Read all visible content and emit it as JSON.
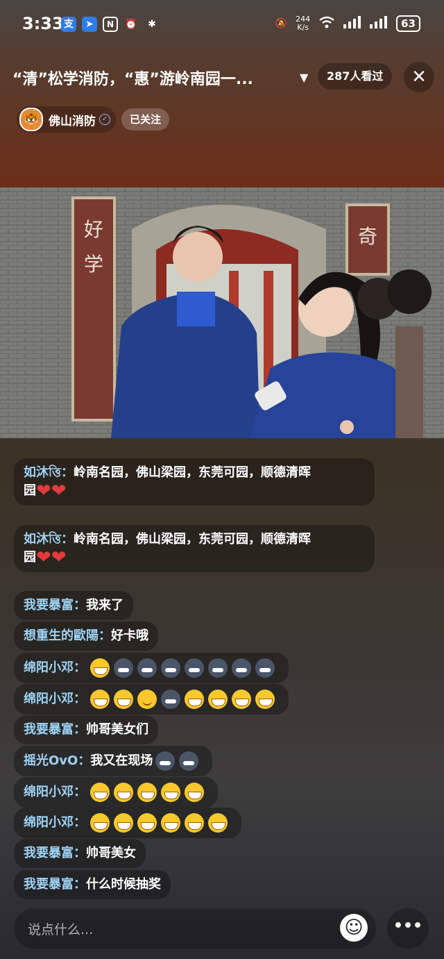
{
  "status_bar": {
    "time": "3:33",
    "icons_left": [
      "alipay-icon",
      "pin-icon",
      "nfc-icon",
      "alarm-off-icon",
      "bluetooth-icon"
    ],
    "speed_value": "244",
    "speed_unit": "K/s",
    "battery": "63"
  },
  "header": {
    "title": "“清”松学消防，“惠”游岭南园一...",
    "viewers": "287人看过",
    "close_icon": "close-icon"
  },
  "host": {
    "name": "佛山消防",
    "follow_label": "已关注"
  },
  "comments": [
    {
      "user": "如沐ত্তি：",
      "msg": "岭南名园，佛山梁园，东莞可园，顺德清晖",
      "msg2": "园",
      "emojis": [
        "heart",
        "heart"
      ]
    },
    {
      "user": "如沐ত্তি：",
      "msg": "岭南名园，佛山梁园，东莞可园，顺德清晖",
      "msg2": "园",
      "emojis": [
        "heart",
        "heart"
      ]
    },
    {
      "user": "我要暴富：",
      "msg": "我来了",
      "emojis": []
    },
    {
      "user": "想重生的歐陽：",
      "msg": "好卡哦",
      "emojis": []
    },
    {
      "user": "绵阳小邓：",
      "msg": "",
      "emojis": [
        "grin",
        "cat",
        "cat",
        "cat",
        "cat",
        "cat",
        "cat",
        "cat"
      ]
    },
    {
      "user": "绵阳小邓：",
      "msg": "",
      "emojis": [
        "grin",
        "grin",
        "smile",
        "cat",
        "grin",
        "grin",
        "grin",
        "grin"
      ]
    },
    {
      "user": "我要暴富：",
      "msg": "帅哥美女们",
      "emojis": []
    },
    {
      "user": "摇光OvO：",
      "msg": "我又在现场",
      "emojis": [
        "cat",
        "cat"
      ]
    },
    {
      "user": "绵阳小邓：",
      "msg": "",
      "emojis": [
        "grin",
        "grin",
        "grin",
        "grin",
        "grin"
      ]
    },
    {
      "user": "绵阳小邓：",
      "msg": "",
      "emojis": [
        "grin",
        "grin",
        "grin",
        "grin",
        "grin",
        "grin"
      ]
    },
    {
      "user": "我要暴富：",
      "msg": "帅哥美女",
      "emojis": []
    },
    {
      "user": "我要暴富：",
      "msg": "什么时候抽奖",
      "emojis": []
    }
  ],
  "input": {
    "placeholder": "说点什么..."
  }
}
